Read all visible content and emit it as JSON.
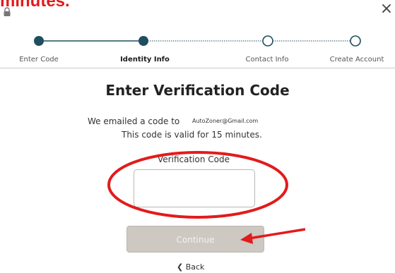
{
  "banner": {
    "text": "minutes."
  },
  "icons": {
    "lock": "lock-icon",
    "close": "close-icon",
    "back": "chevron-left-icon",
    "arrow": "red-arrow"
  },
  "header": {
    "close_glyph": "×"
  },
  "stepper": {
    "steps": [
      {
        "label": "Enter Code",
        "state": "complete"
      },
      {
        "label": "Identity Info",
        "state": "current"
      },
      {
        "label": "Contact Info",
        "state": "upcoming"
      },
      {
        "label": "Create Account",
        "state": "upcoming"
      }
    ],
    "colors": {
      "complete": "#1f4e5f",
      "upcoming": "#ffffff",
      "line": "#1f4e5f"
    }
  },
  "main": {
    "title": "Enter Verification Code",
    "message_line1": "We emailed a code to",
    "email": "AutoZoner@Gmail.com",
    "message_line2": "This code is valid for 15 minutes.",
    "field_label": "Verification Code",
    "field_value": "",
    "continue_label": "Continue",
    "back_label": "Back"
  },
  "annotation_color": "#e21b1b"
}
